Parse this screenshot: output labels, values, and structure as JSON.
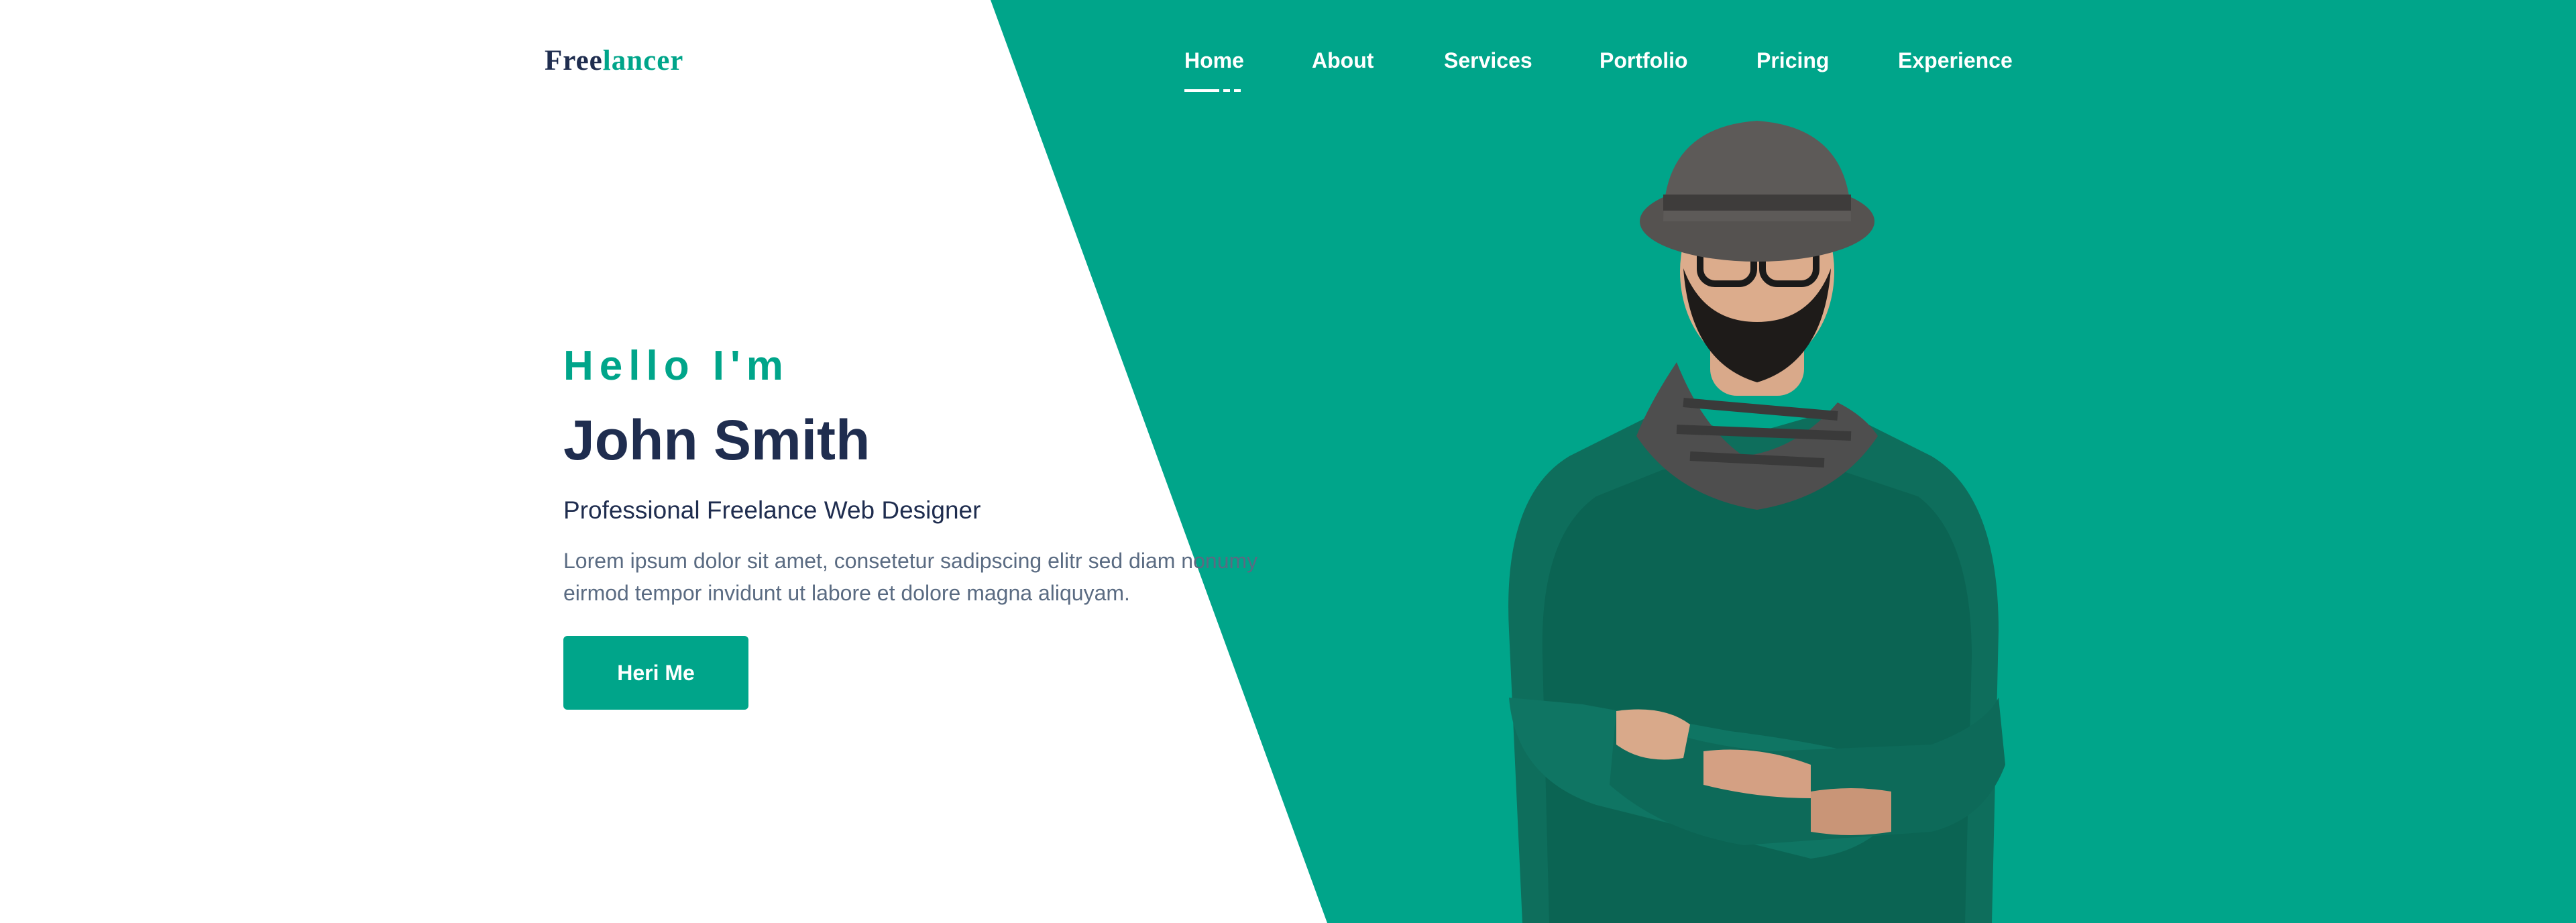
{
  "logo": {
    "part1": "Free",
    "part2": "lancer"
  },
  "nav": {
    "items": [
      {
        "label": "Home",
        "active": true
      },
      {
        "label": "About"
      },
      {
        "label": "Services"
      },
      {
        "label": "Portfolio"
      },
      {
        "label": "Pricing"
      },
      {
        "label": "Experience"
      }
    ]
  },
  "hero": {
    "greeting": "Hello I'm",
    "name": "John Smith",
    "subtitle": "Professional Freelance Web Designer",
    "description": "Lorem ipsum dolor sit amet, consetetur sadipscing elitr sed diam nonumy eirmod tempor invidunt ut labore et dolore magna aliquyam.",
    "button_label": "Heri Me"
  },
  "colors": {
    "accent": "#00a58a",
    "heading": "#1f2d4f",
    "body_text": "#5a6b82"
  }
}
